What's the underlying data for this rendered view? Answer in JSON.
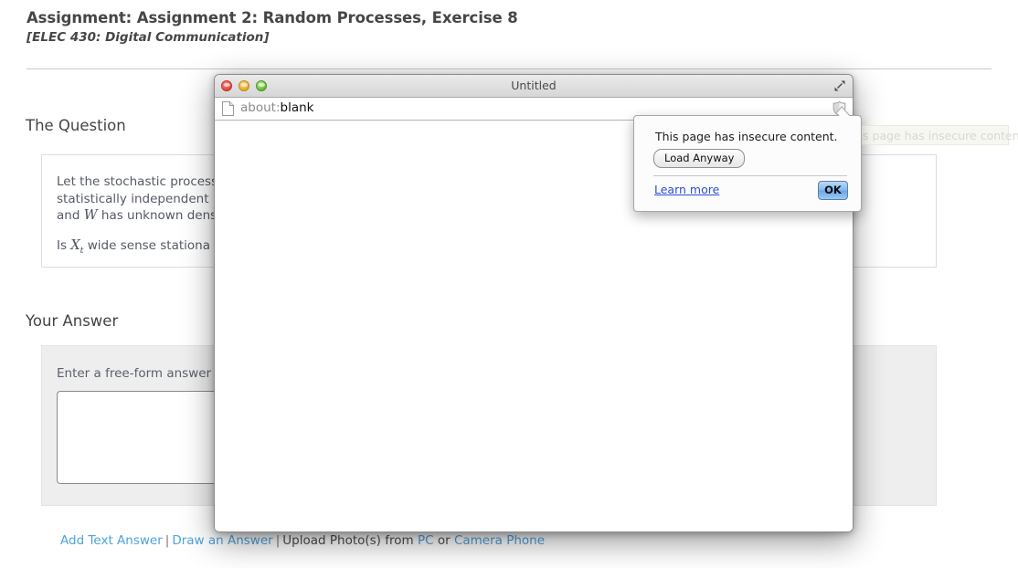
{
  "page": {
    "assignment_title": "Assignment: Assignment 2: Random Processes, Exercise 8",
    "course_title": "[ELEC 430: Digital Communication]",
    "question_heading": "The Question",
    "question_paragraph_1_a": "Let the stochastic process",
    "question_paragraph_1_b": "statistically independent r",
    "question_paragraph_1_c": "and",
    "question_var_w": "W",
    "question_paragraph_1_d": "has unknown dens",
    "question_paragraph_2_a": "Is",
    "question_var_x": "X",
    "question_var_x_sub": "t",
    "question_paragraph_2_b": "wide sense stationa",
    "answer_heading": "Your Answer",
    "answer_label": "Enter a free-form answer",
    "answer_value": "",
    "answer_placeholder": "",
    "links": {
      "add_text_answer": "Add Text Answer",
      "draw_an_answer": "Draw an Answer",
      "upload_prefix": "Upload Photo(s) from",
      "pc": "PC",
      "or": "or",
      "camera_phone": "Camera Phone",
      "separator": "|"
    },
    "link_color": "#4ea3dd"
  },
  "browser": {
    "window_title": "Untitled",
    "url_scheme": "about:",
    "url_rest": "blank",
    "traffic_lights": [
      {
        "name": "close",
        "color": "#e0443b"
      },
      {
        "name": "minimize",
        "color": "#e9a922"
      },
      {
        "name": "zoom",
        "color": "#64b93a"
      }
    ],
    "icons": {
      "document": "page-icon",
      "shield": "shield-icon",
      "fullscreen": "fullscreen-icon"
    }
  },
  "popup": {
    "message": "This page has insecure content.",
    "load_anyway": "Load Anyway",
    "learn_more": "Learn more",
    "ok": "OK",
    "ghost_message": "This page has insecure content.",
    "ok_color": "#86b9ef",
    "link_color": "#2b4fd4"
  }
}
